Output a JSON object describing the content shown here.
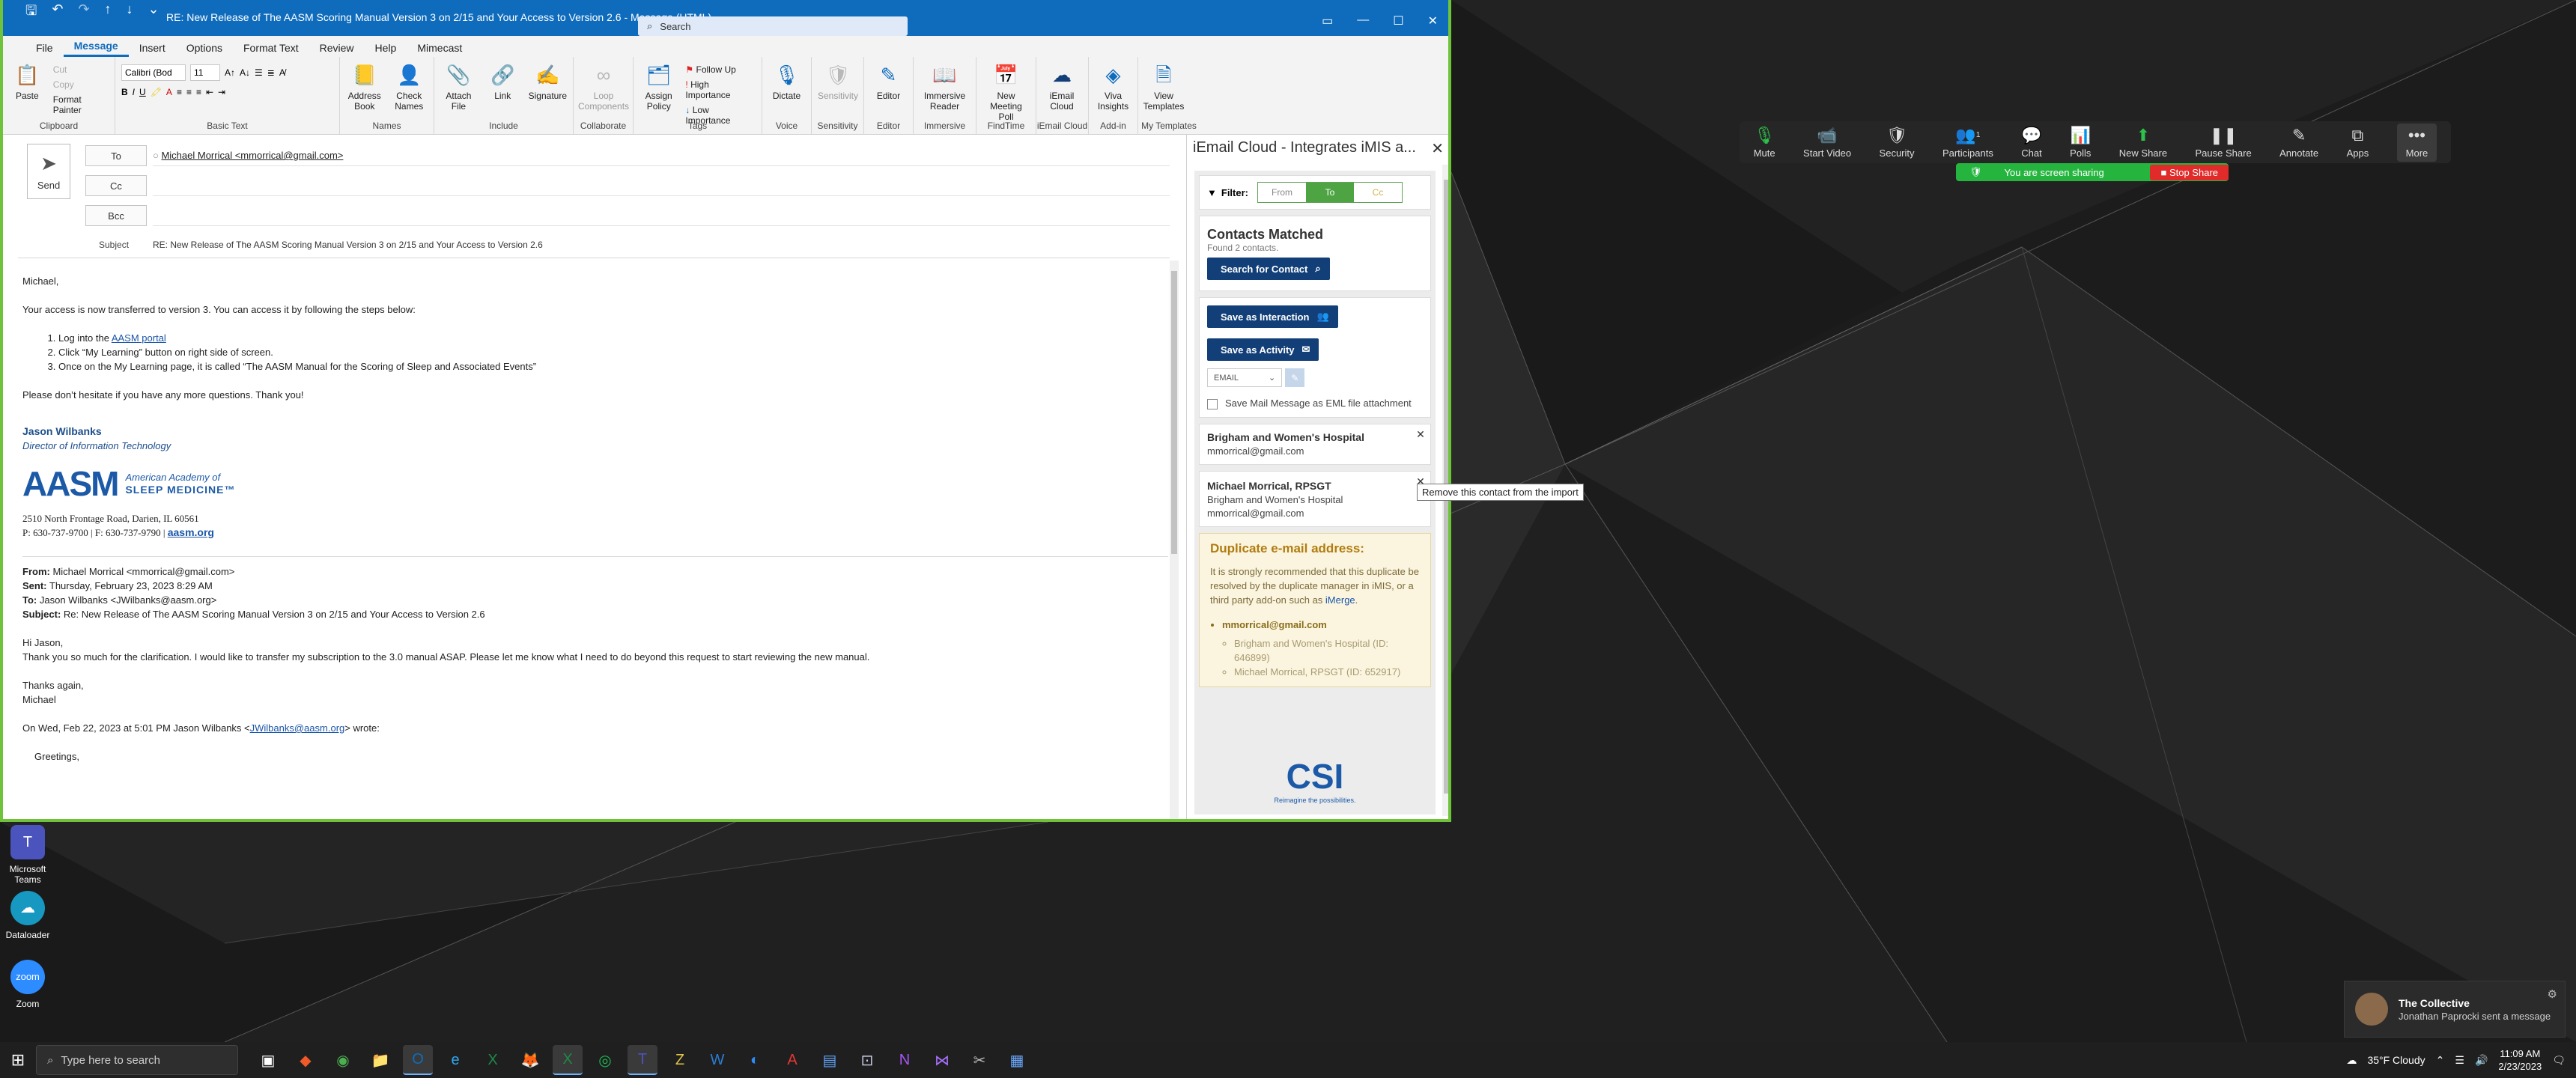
{
  "outlook": {
    "quick_access": [
      "save-icon",
      "undo-icon",
      "redo-icon",
      "up-icon",
      "down-icon",
      "customize-icon"
    ],
    "title": "RE: New Release of The AASM Scoring Manual Version 3 on 2/15 and Your Access to Version 2.6  -  Message (HTML)",
    "search_placeholder": "Search",
    "menu": [
      "File",
      "Message",
      "Insert",
      "Options",
      "Format Text",
      "Review",
      "Help",
      "Mimecast"
    ],
    "active_menu": "Message",
    "ribbon": {
      "clipboard": {
        "label": "Clipboard",
        "paste": "Paste",
        "cut": "Cut",
        "copy": "Copy",
        "format_painter": "Format Painter"
      },
      "basic_text": {
        "label": "Basic Text",
        "font": "Calibri (Bod",
        "size": "11",
        "bold": "B",
        "italic": "I",
        "underline": "U"
      },
      "names": {
        "label": "Names",
        "address_book": "Address Book",
        "check_names": "Check Names"
      },
      "include": {
        "label": "Include",
        "attach": "Attach File",
        "link": "Link",
        "signature": "Signature"
      },
      "collaborate": {
        "label": "Collaborate",
        "loop": "Loop Components"
      },
      "tags": {
        "label": "Tags",
        "assign": "Assign Policy",
        "follow_up": "Follow Up",
        "high": "High Importance",
        "low": "Low Importance"
      },
      "voice": {
        "label": "Voice",
        "dictate": "Dictate"
      },
      "sensitivity": {
        "label": "Sensitivity",
        "btn": "Sensitivity"
      },
      "editor": {
        "label": "Editor",
        "btn": "Editor"
      },
      "immersive": {
        "label": "Immersive",
        "btn": "Immersive Reader"
      },
      "findtime": {
        "label": "FindTime",
        "btn": "New Meeting Poll"
      },
      "iemail": {
        "label": "iEmail Cloud",
        "btn": "iEmail Cloud"
      },
      "addin": {
        "label": "Add-in",
        "btn": "Viva Insights"
      },
      "templates": {
        "label": "My Templates",
        "btn": "View Templates"
      }
    }
  },
  "compose": {
    "send": "Send",
    "to_label": "To",
    "cc_label": "Cc",
    "bcc_label": "Bcc",
    "to_value": "Michael Morrical <mmorrical@gmail.com>",
    "subject_label": "Subject",
    "subject": "RE: New Release of The AASM Scoring Manual Version 3 on 2/15 and Your Access to Version 2.6"
  },
  "email": {
    "greeting": "Michael,",
    "p1": "Your access is now transferred to version 3. You can access it by following the steps below:",
    "step1_pre": "Log into the ",
    "step1_link": "AASM portal",
    "step2": "Click “My Learning” button on right side of screen.",
    "step3": "Once on the My Learning page, it is called “The AASM Manual for the Scoring of Sleep and Associated Events”",
    "p2": "Please don’t hesitate if you have any more questions. Thank you!",
    "sig_name": "Jason Wilbanks",
    "sig_title": "Director of Information Technology",
    "logo_big": "AASM",
    "logo_line1": "American Academy of",
    "logo_line2": "SLEEP MEDICINE™",
    "address": "2510 North Frontage Road, Darien, IL 60561",
    "phone": "P: 630-737-9700 | F: 630-737-9790 | ",
    "site": "aasm.org",
    "q_from_label": "From:",
    "q_from": " Michael Morrical <mmorrical@gmail.com>",
    "q_sent_label": "Sent:",
    "q_sent": " Thursday, February 23, 2023 8:29 AM",
    "q_to_label": "To:",
    "q_to": " Jason Wilbanks <JWilbanks@aasm.org>",
    "q_subj_label": "Subject:",
    "q_subj": " Re: New Release of The AASM Scoring Manual Version 3 on 2/15 and Your Access to Version 2.6",
    "q_hi": "Hi Jason,",
    "q_body": "Thank you so much for the clarification. I would like to transfer my subscription to the 3.0 manual ASAP. Please let me know what I need to do beyond this request to start reviewing the new manual.",
    "q_thanks": "Thanks again,",
    "q_name": "Michael",
    "q_wrote_pre": "On Wed, Feb 22, 2023 at 5:01 PM Jason Wilbanks <",
    "q_wrote_link": "JWilbanks@aasm.org",
    "q_wrote_post": "> wrote:",
    "q_greet": "Greetings,"
  },
  "pane": {
    "title": "iEmail Cloud - Integrates iMIS a...",
    "filter_label": "Filter:",
    "filter_from": "From",
    "filter_to": "To",
    "filter_cc": "Cc",
    "matched_title": "Contacts Matched",
    "matched_sub": "Found 2 contacts.",
    "search_btn": "Search for Contact",
    "save_interaction": "Save as Interaction",
    "save_activity": "Save as Activity",
    "activity_type": "EMAIL",
    "eml_label": "Save Mail Message as EML file attachment",
    "contact1_name": "Brigham and Women's Hospital",
    "contact1_email": "mmorrical@gmail.com",
    "contact2_name": "Michael Morrical, RPSGT",
    "contact2_org": "Brigham and Women's Hospital",
    "contact2_email": "mmorrical@gmail.com",
    "dup_title": "Duplicate e-mail address:",
    "dup_text_pre": "It is strongly recommended that this duplicate be resolved by the duplicate manager in iMIS, or a third party add-on such as ",
    "dup_link": "iMerge",
    "dup_text_post": ".",
    "dup_email": "mmorrical@gmail.com",
    "dup_item1": "Brigham and Women's Hospital (ID: 646899)",
    "dup_item2": "Michael Morrical, RPSGT (ID: 652917)",
    "csi_logo": "CSI",
    "csi_tag": "Reimagine the possibilities.",
    "tooltip": "Remove this contact from the import"
  },
  "zoom": {
    "items": [
      {
        "label": "Mute",
        "icon": "microphone-icon"
      },
      {
        "label": "Start Video",
        "icon": "video-off-icon"
      },
      {
        "label": "Security",
        "icon": "shield-icon"
      },
      {
        "label": "Participants",
        "icon": "participants-icon",
        "count": "1"
      },
      {
        "label": "Chat",
        "icon": "chat-icon"
      },
      {
        "label": "Polls",
        "icon": "polls-icon"
      },
      {
        "label": "New Share",
        "icon": "share-icon"
      },
      {
        "label": "Pause Share",
        "icon": "pause-icon"
      },
      {
        "label": "Annotate",
        "icon": "pen-icon"
      },
      {
        "label": "Apps",
        "icon": "apps-icon"
      },
      {
        "label": "More",
        "icon": "more-icon"
      }
    ],
    "sharing": "You are screen sharing",
    "stop": "Stop Share"
  },
  "desktop": {
    "teams": "Microsoft Teams",
    "dataloader": "Dataloader",
    "zoom": "Zoom"
  },
  "toast": {
    "title": "The Collective",
    "msg": "Jonathan Paprocki sent a message"
  },
  "taskbar": {
    "search": "Type here to search",
    "weather": "35°F  Cloudy",
    "time": "11:09 AM",
    "date": "2/23/2023"
  },
  "colors": {
    "outlook_blue": "#0f6cbd",
    "window_border": "#6fc33a",
    "zoom_green": "#25b53f",
    "pane_button": "#123f78"
  }
}
